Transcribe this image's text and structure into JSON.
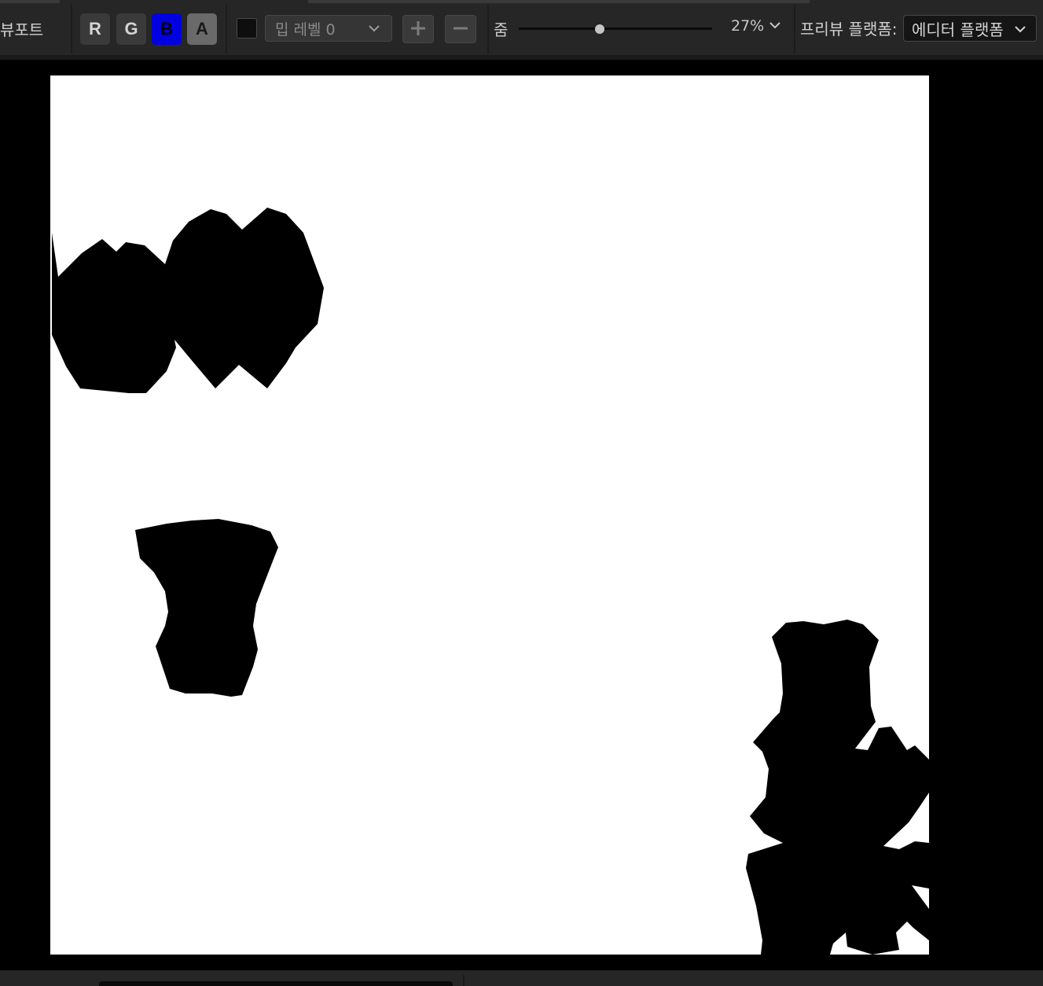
{
  "toolbar": {
    "viewport_label": "뷰포트",
    "channels": [
      {
        "label": "R",
        "state": "off"
      },
      {
        "label": "G",
        "state": "off"
      },
      {
        "label": "B",
        "state": "on"
      },
      {
        "label": "A",
        "state": "on"
      }
    ],
    "mip_select": "밉 레벨 0",
    "zoom_label": "줌",
    "zoom_value": "27%",
    "zoom_slider_fraction": 0.42,
    "preview_platform_label": "프리뷰 플랫폼:",
    "preview_platform_value": "에디터 플랫폼"
  },
  "colors": {
    "toolbar_bg": "#262626",
    "channel_b_active": "#0000e0",
    "canvas_bg": "#ffffff",
    "shape_fill": "#000000"
  },
  "icons": {
    "mip_dropdown": "chevron-down-icon",
    "zoom_dropdown": "chevron-down-icon",
    "platform_dropdown": "chevron-down-icon",
    "increase": "plus-icon",
    "decrease": "minus-icon"
  }
}
